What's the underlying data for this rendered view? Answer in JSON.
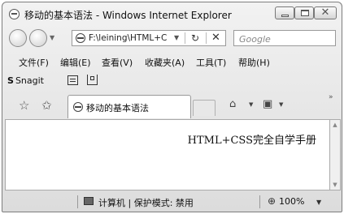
{
  "window": {
    "title": "移动的基本语法 - Windows Internet Explorer"
  },
  "nav": {
    "address": "F:\\leining\\HTML+C",
    "search_placeholder": "Google"
  },
  "menu": {
    "items": [
      "文件(F)",
      "编辑(E)",
      "查看(V)",
      "收藏夹(A)",
      "工具(T)",
      "帮助(H)"
    ]
  },
  "links": {
    "snagit": "Snagit"
  },
  "tab": {
    "label": "移动的基本语法"
  },
  "content": {
    "heading": "HTML+CSS完全自学手册"
  },
  "status": {
    "zone": "计算机",
    "protected_mode": "保护模式: 禁用",
    "zoom": "100%"
  }
}
